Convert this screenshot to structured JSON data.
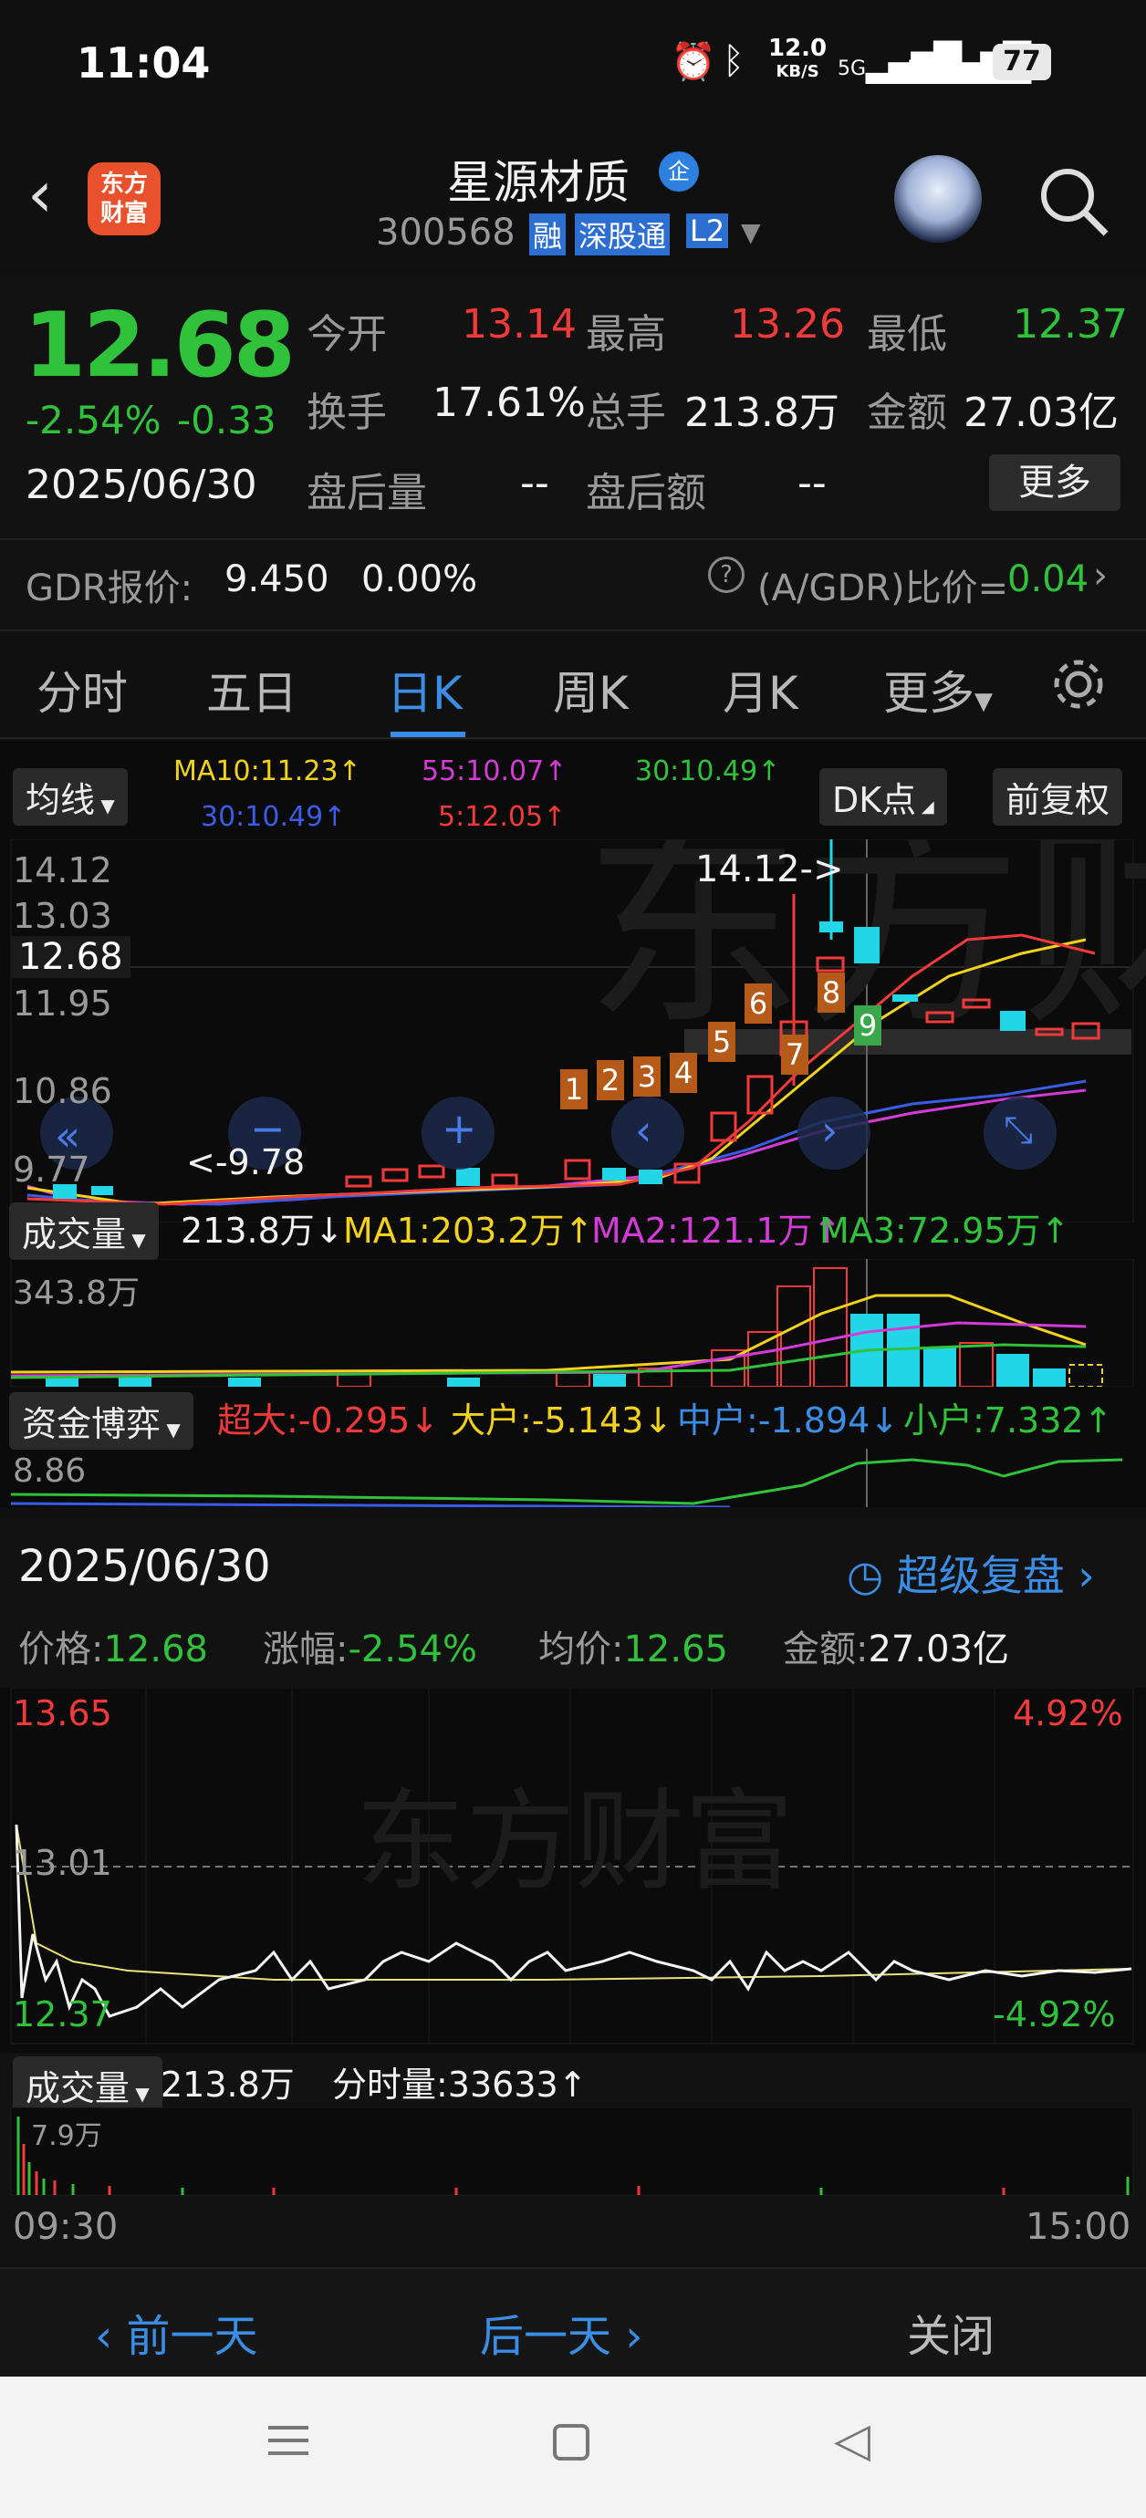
{
  "status": {
    "time": "11:04",
    "speed": "12.0",
    "speed_unit": "KB/S",
    "sig1": "5G",
    "sig2": "5G",
    "battery": "77"
  },
  "header": {
    "logo_line1": "东方",
    "logo_line2": "财富",
    "stock_name": "星源材质",
    "badge": "企",
    "code": "300568",
    "tag_rong": "融",
    "tag_sgt": "深股通",
    "tag_l2": "L2"
  },
  "quote": {
    "price": "12.68",
    "pct": "-2.54%",
    "chg": "-0.33",
    "date": "2025/06/30",
    "open_label": "今开",
    "open": "13.14",
    "high_label": "最高",
    "high": "13.26",
    "low_label": "最低",
    "low": "12.37",
    "turnover_label": "换手",
    "turnover": "17.61%",
    "vol_label": "总手",
    "vol": "213.8万",
    "amount_label": "金额",
    "amount": "27.03亿",
    "after_vol_label": "盘后量",
    "after_vol": "--",
    "after_amt_label": "盘后额",
    "after_amt": "--",
    "more": "更多",
    "gdr_label": "GDR报价:",
    "gdr_price": "9.450",
    "gdr_pct": "0.00%",
    "ratio_label": "(A/GDR)比价=",
    "ratio": "0.04"
  },
  "tabs": [
    "分时",
    "五日",
    "日K",
    "周K",
    "月K",
    "更多"
  ],
  "kchart": {
    "ma_pill": "均线",
    "ma10": "MA10:11.23↑",
    "ma55": "55:10.07↑",
    "ma30a": "30:10.49↑",
    "ma30b": "30:10.49↑",
    "ma5": "5:12.05↑",
    "dk": "DK点",
    "fq": "前复权",
    "y1": "14.12",
    "y2": "13.03",
    "y3": "11.95",
    "y4": "10.86",
    "y5": "9.77",
    "cur": "12.68",
    "high_anno": "14.12->",
    "low_anno": "<-9.78",
    "nums": [
      "1",
      "2",
      "3",
      "4",
      "5",
      "6",
      "7",
      "8",
      "9"
    ],
    "vol_pill": "成交量",
    "vol": "213.8万↓",
    "vma1": "MA1:203.2万↑",
    "vma2": "MA2:121.1万↑",
    "vma3": "MA3:72.95万↑",
    "vol_axis": "343.8万",
    "zj_pill": "资金博弈",
    "cd": "超大:-0.295↓",
    "dh": "大户:-5.143↓",
    "zh": "中户:-1.894↓",
    "xh": "小户:7.332↑",
    "zj_axis": "8.86"
  },
  "detail": {
    "date": "2025/06/30",
    "replay": "超级复盘",
    "price_l": "价格:",
    "price": "12.68",
    "pct_l": "涨幅:",
    "pct": "-2.54%",
    "avg_l": "均价:",
    "avg": "12.65",
    "amt_l": "金额:",
    "amt": "27.03亿",
    "top": "13.65",
    "top_pct": "4.92%",
    "mid": "13.01",
    "bot": "12.37",
    "bot_pct": "-4.92%",
    "vol_pill": "成交量",
    "vol": "213.8万",
    "fs_vol": "分时量:33633↑",
    "vol_axis": "7.9万",
    "t_start": "09:30",
    "t_end": "15:00"
  },
  "footer": {
    "prev": "前一天",
    "next": "后一天",
    "close": "关闭"
  },
  "colors": {
    "up": "#f23a3a",
    "down": "#2fc23a",
    "accent": "#3a8ee6"
  }
}
